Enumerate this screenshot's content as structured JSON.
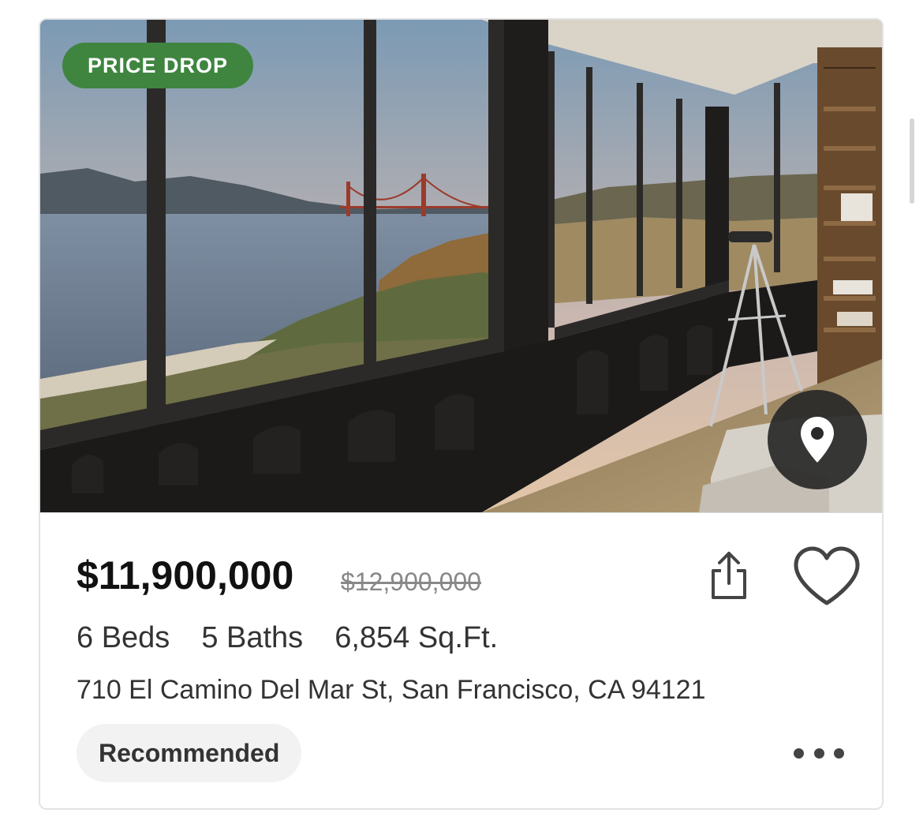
{
  "listing": {
    "badge": "PRICE DROP",
    "price": "$11,900,000",
    "original_price": "$12,900,000",
    "beds": "6 Beds",
    "baths": "5 Baths",
    "sqft": "6,854 Sq.Ft.",
    "address": "710 El Camino Del Mar St, San Francisco, CA 94121",
    "tag": "Recommended"
  },
  "icons": {
    "map": "map-pin-icon",
    "share": "share-icon",
    "favorite": "heart-icon",
    "more": "more-horizontal-icon"
  },
  "colors": {
    "badge": "#3f8540",
    "price": "#111111",
    "muted": "#888888",
    "tag_bg": "#f2f2f2"
  }
}
